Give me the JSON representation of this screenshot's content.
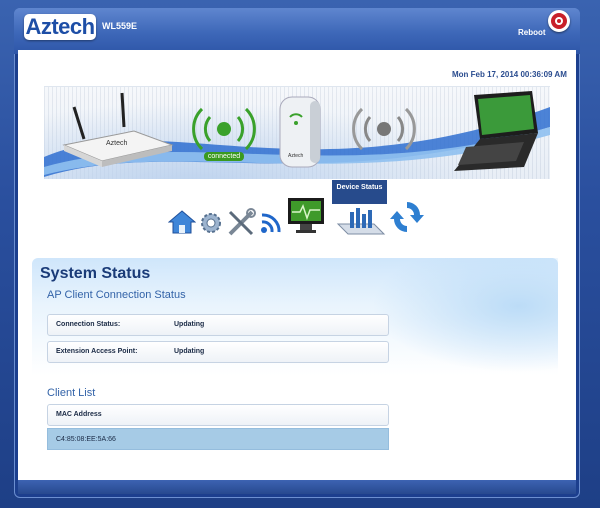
{
  "header": {
    "logo_text": "Aztech",
    "model": "WL559E",
    "reboot_label": "Reboot"
  },
  "datetime": "Mon Feb 17, 2014 00:36:09 AM",
  "banner": {
    "connected_label": "connected"
  },
  "nav": {
    "items": [
      {
        "icon": "home-icon"
      },
      {
        "icon": "gear-icon"
      },
      {
        "icon": "tools-icon"
      },
      {
        "icon": "wireless-icon"
      },
      {
        "icon": "monitor-icon"
      },
      {
        "icon": "device-status-icon",
        "label": "Device Status",
        "active": true
      },
      {
        "icon": "refresh-icon"
      }
    ]
  },
  "main": {
    "title": "System Status",
    "ap_section_title": "AP Client Connection Status",
    "ap_rows": [
      {
        "label": "Connection Status:",
        "value": "Updating"
      },
      {
        "label": "Extension Access Point:",
        "value": "Updating"
      }
    ],
    "client_section_title": "Client List",
    "client_columns": [
      "MAC Address"
    ],
    "client_rows": [
      {
        "mac": "C4:85:08:EE:5A:66"
      }
    ]
  },
  "colors": {
    "brand_blue": "#2e56a8",
    "connected_green": "#3a9a1f",
    "reboot_red": "#c8202a",
    "selected_row": "#a6cbe6"
  }
}
